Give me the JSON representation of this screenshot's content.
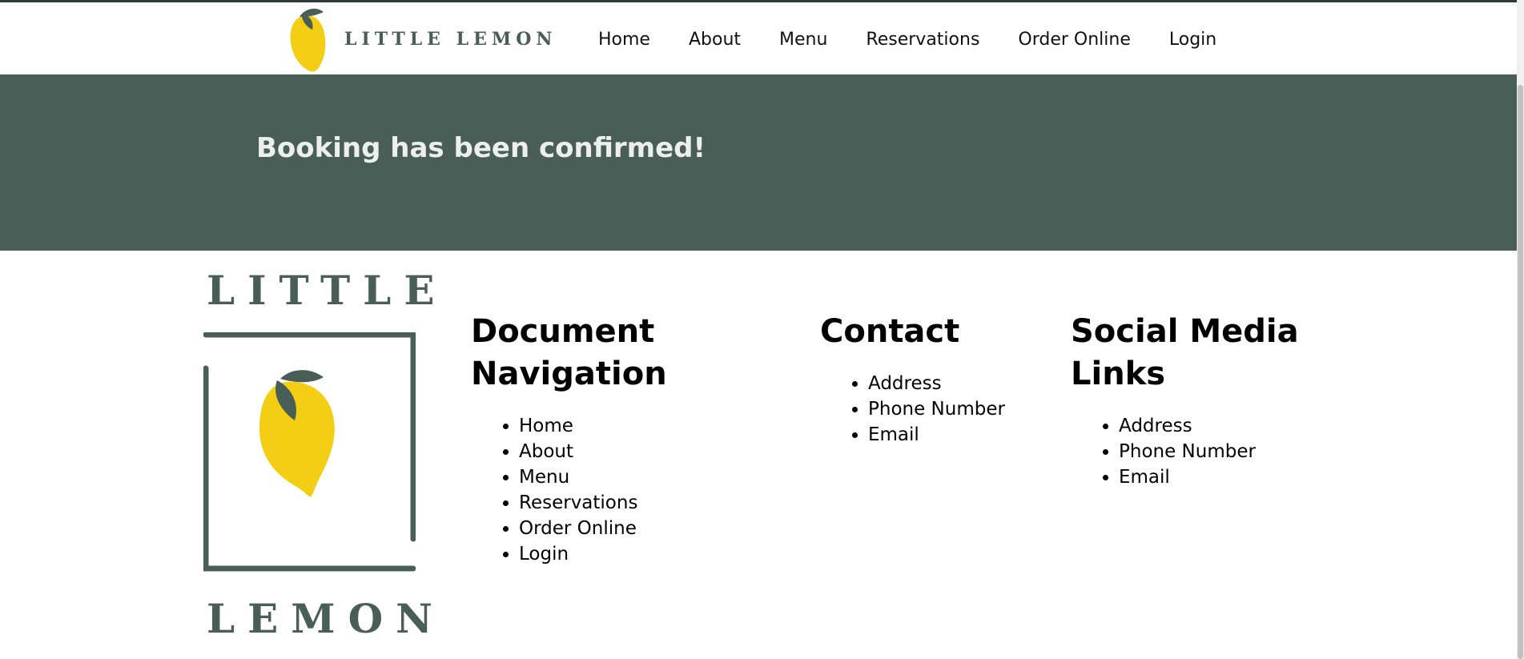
{
  "brand": {
    "name": "LITTLE LEMON",
    "logo_icon": "lemon-icon",
    "colors": {
      "green": "#495e57",
      "yellow": "#f4ce14",
      "light": "#edefee"
    }
  },
  "nav": {
    "links": [
      "Home",
      "About",
      "Menu",
      "Reservations",
      "Order Online",
      "Login"
    ]
  },
  "hero": {
    "title": "Booking has been confirmed!"
  },
  "footer": {
    "logo_top": "LITTLE",
    "logo_bottom": "LEMON",
    "doc_nav": {
      "heading_line1": "Document",
      "heading_line2": "Navigation",
      "items": [
        "Home",
        "About",
        "Menu",
        "Reservations",
        "Order Online",
        "Login"
      ]
    },
    "contact": {
      "heading": "Contact",
      "items": [
        "Address",
        "Phone Number",
        "Email"
      ]
    },
    "social": {
      "heading_line1": "Social Media",
      "heading_line2": "Links",
      "items": [
        "Address",
        "Phone Number",
        "Email"
      ]
    }
  }
}
